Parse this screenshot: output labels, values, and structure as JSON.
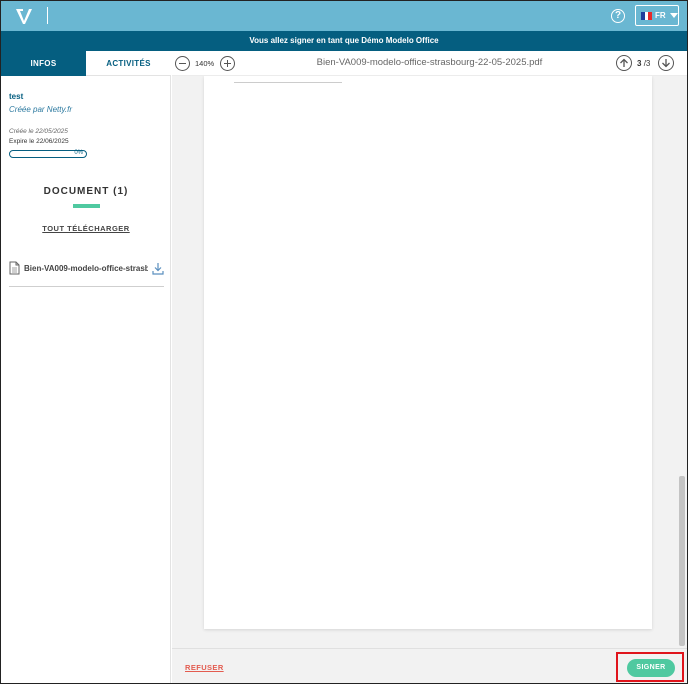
{
  "topbar": {
    "logo_icon": "netty-logo-icon",
    "help_icon": "help-icon",
    "language": {
      "code": "FR",
      "flag": "fr-flag-icon"
    }
  },
  "banner": {
    "text": "Vous allez signer en tant que Démo Modelo Office"
  },
  "sidebar": {
    "tabs": [
      {
        "label": "INFOS",
        "active": true
      },
      {
        "label": "ACTIVITÉS",
        "active": false
      }
    ],
    "signature": {
      "title": "test",
      "creator": "Créée par Netty.fr",
      "created": "Créée le 22/05/2025",
      "expires": "Expire le 22/06/2025",
      "progress_label": "0%",
      "progress": 0
    },
    "documents_heading": "DOCUMENT (1)",
    "download_all": "TOUT TÉLÉCHARGER",
    "files": [
      {
        "name": "Bien-VA009-modelo-office-strasb",
        "icon": "file-icon",
        "download_icon": "download-icon"
      }
    ]
  },
  "viewer": {
    "zoom": "140%",
    "filename": "Bien-VA009-modelo-office-strasbourg-22-05-2025.pdf",
    "page_current": "3",
    "page_total": "/3"
  },
  "footer": {
    "refuse_label": "REFUSER",
    "sign_label": "SIGNER"
  },
  "colors": {
    "topbar": "#6ab7d2",
    "banner": "#055e80",
    "accent_green": "#4fc9a0",
    "refuse_red": "#e35b4f",
    "highlight_red": "#e0141c"
  }
}
